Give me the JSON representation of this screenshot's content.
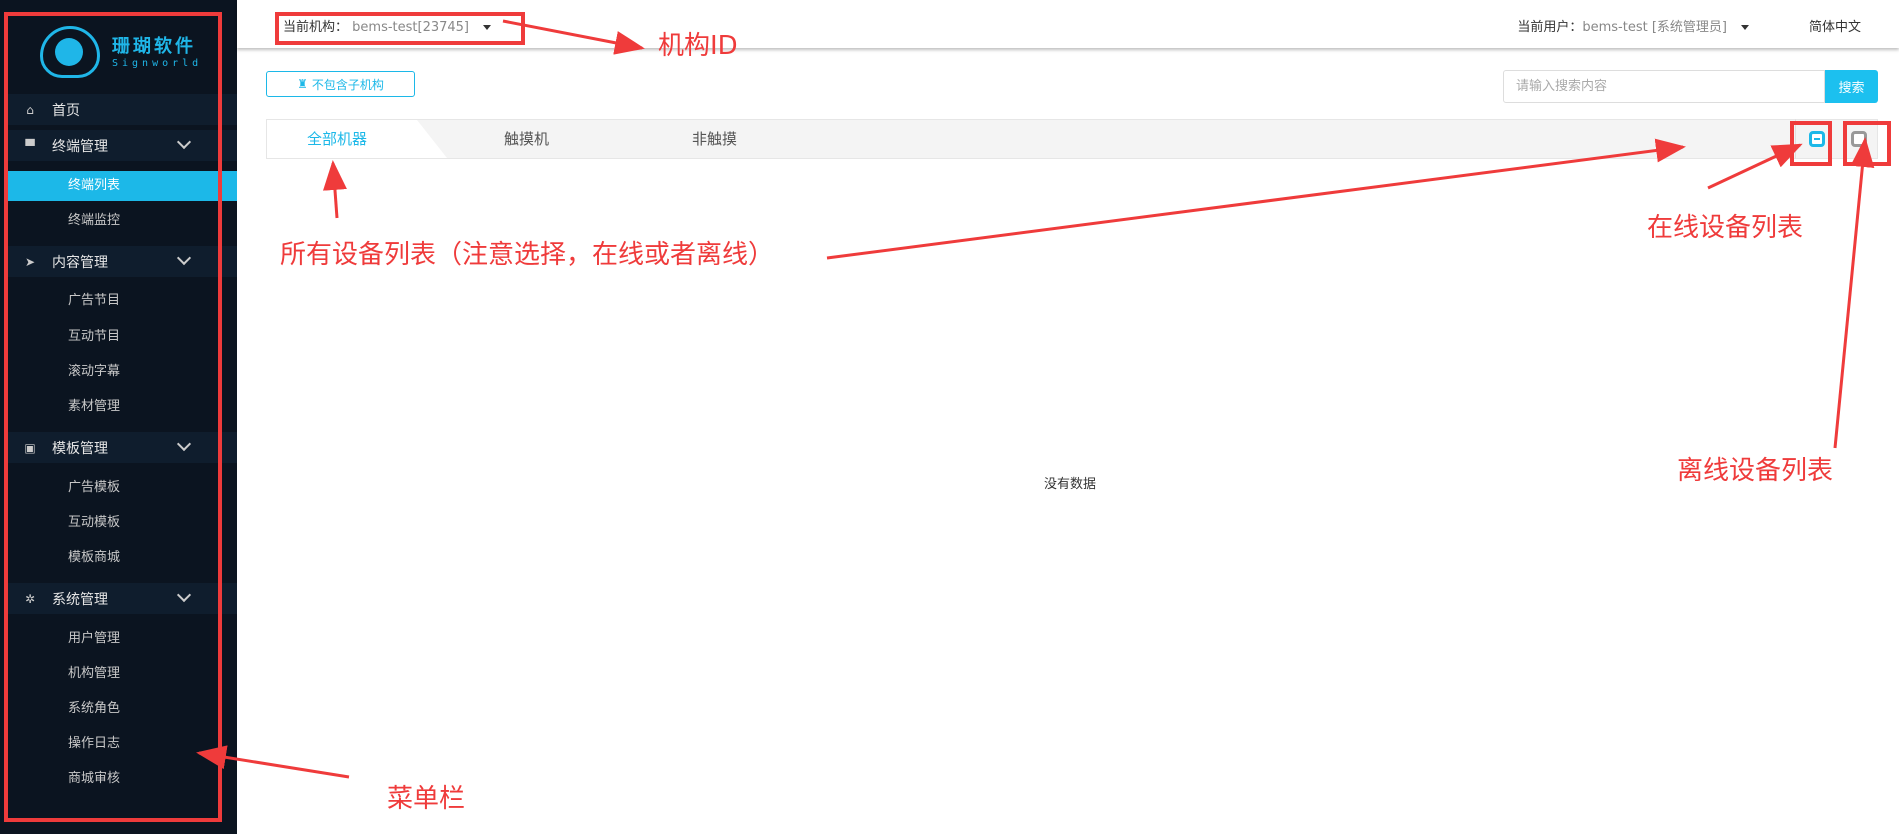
{
  "logo": {
    "name": "珊瑚软件",
    "sub": "Signworld"
  },
  "sidebar": {
    "home": "首页",
    "groups": [
      {
        "label": "终端管理",
        "items": [
          "终端列表",
          "终端监控"
        ]
      },
      {
        "label": "内容管理",
        "items": [
          "广告节目",
          "互动节目",
          "滚动字幕",
          "素材管理"
        ]
      },
      {
        "label": "模板管理",
        "items": [
          "广告模板",
          "互动模板",
          "模板商城"
        ]
      },
      {
        "label": "系统管理",
        "items": [
          "用户管理",
          "机构管理",
          "系统角色",
          "操作日志",
          "商城审核"
        ]
      }
    ]
  },
  "topbar": {
    "org_label": "当前机构：",
    "org_value": "bems-test[23745]",
    "user_label": "当前用户：",
    "user_value": "bems-test [系统管理员]",
    "language": "简体中文"
  },
  "toolbar": {
    "sub_org_button": "不包含子机构",
    "search_placeholder": "请输入搜索内容",
    "search_button": "搜索"
  },
  "tabs": [
    "全部机器",
    "触摸机",
    "非触摸"
  ],
  "empty_text": "没有数据",
  "annotations": {
    "org_id": "机构ID",
    "all_devices": "所有设备列表（注意选择，在线或者离线）",
    "online": "在线设备列表",
    "offline": "离线设备列表",
    "menu": "菜单栏"
  },
  "colors": {
    "accent": "#1cb8e8",
    "annotation": "#ef3b3b",
    "sidebar": "#0b1420"
  }
}
